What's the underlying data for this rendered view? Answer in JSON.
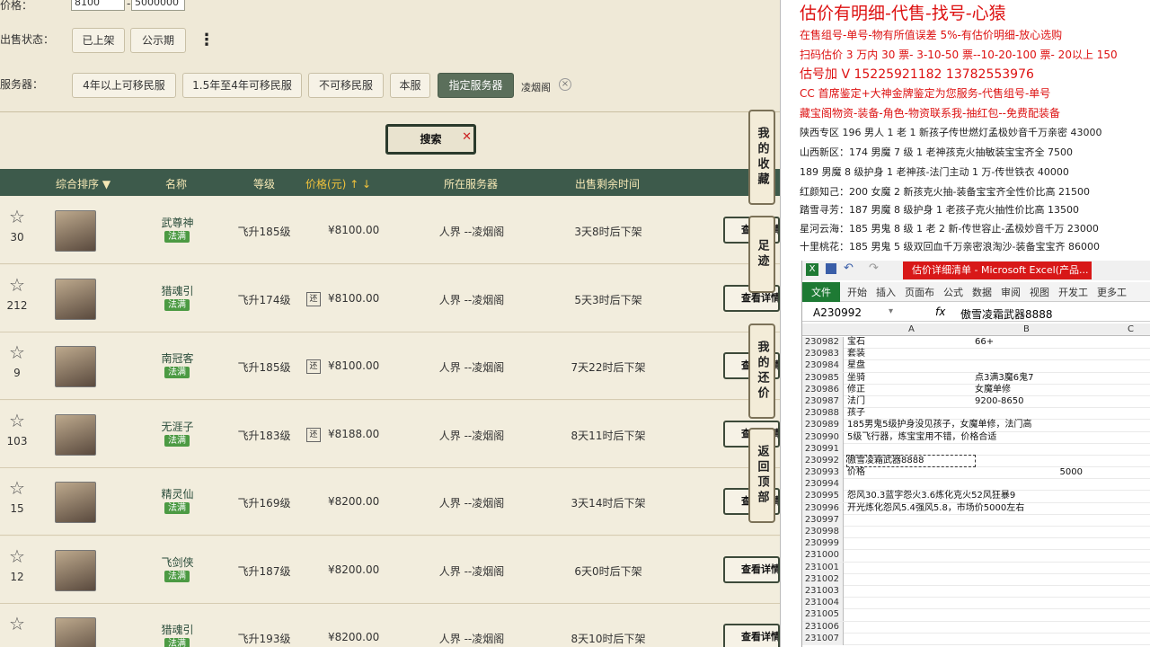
{
  "filters": {
    "price_label": "价格：",
    "price_min": "8100",
    "price_sep": "-",
    "price_max": "5000000",
    "sale_status_label": "出售状态：",
    "sale_status_options": [
      "已上架",
      "公示期"
    ],
    "more": "⋮",
    "server_label": "服务器：",
    "server_options": [
      "4年以上可移民服",
      "1.5年至4年可移民服",
      "不可移民服",
      "本服",
      "指定服务器"
    ],
    "server_selected": "凌烟阁",
    "search_label": "搜索"
  },
  "table": {
    "headers": [
      "综合排序",
      "名称",
      "等级",
      "价格(元)",
      "所在服务器",
      "出售剩余时间"
    ],
    "rows": [
      {
        "fav": "30",
        "name": "武尊神",
        "tag": "法满",
        "level": "飞升185级",
        "hint": "",
        "price": "¥8100.00",
        "server": "人界 --凌烟阁",
        "time": "3天8时后下架",
        "action": "查看详情"
      },
      {
        "fav": "212",
        "name": "猎魂引",
        "tag": "法满",
        "level": "飞升174级",
        "hint": "还",
        "price": "¥8100.00",
        "server": "人界 --凌烟阁",
        "time": "5天3时后下架",
        "action": "查看详情"
      },
      {
        "fav": "9",
        "name": "南冠客",
        "tag": "法满",
        "level": "飞升185级",
        "hint": "还",
        "price": "¥8100.00",
        "server": "人界 --凌烟阁",
        "time": "7天22时后下架",
        "action": "查看详情"
      },
      {
        "fav": "103",
        "name": "无涯子",
        "tag": "法满",
        "level": "飞升183级",
        "hint": "还",
        "price": "¥8188.00",
        "server": "人界 --凌烟阁",
        "time": "8天11时后下架",
        "action": "查看详情"
      },
      {
        "fav": "15",
        "name": "精灵仙",
        "tag": "法满",
        "level": "飞升169级",
        "hint": "",
        "price": "¥8200.00",
        "server": "人界 --凌烟阁",
        "time": "3天14时后下架",
        "action": "查看详情"
      },
      {
        "fav": "12",
        "name": "飞剑侠",
        "tag": "法满",
        "level": "飞升187级",
        "hint": "",
        "price": "¥8200.00",
        "server": "人界 --凌烟阁",
        "time": "6天0时后下架",
        "action": "查看详情"
      },
      {
        "fav": "",
        "name": "猎魂引",
        "tag": "法满",
        "level": "飞升193级",
        "hint": "",
        "price": "¥8200.00",
        "server": "人界 --凌烟阁",
        "time": "8天10时后下架",
        "action": "查看详情"
      }
    ]
  },
  "side_nav": [
    "我的收藏",
    "足迹",
    "我的还价",
    "返回顶部"
  ],
  "promo": {
    "headline": "估价有明细-代售-找号-心猿",
    "red_lines": [
      "在售组号-单号-物有所值误差 5%-有估价明细-放心选购",
      "扫码估价 3 万内 30 票- 3-10-50 票--10-20-100 票- 20以上 150",
      "估号加 V 15225921182   13782553976",
      "CC 首席鉴定+大神金牌鉴定为您服务-代售组号-单号",
      "藏宝阁物资-装备-角色-物资联系我-抽红包--免费配装备"
    ],
    "listings": [
      "陕西专区 196 男人 1 老 1 新孩子传世燃灯孟极妙音千万亲密 43000",
      "山西新区：174 男魔 7 级 1 老神孩克火抽敏装宝宝齐全 7500",
      "189 男魔 8 级护身 1 老神孩-法门主动 1 万-传世铁衣 40000",
      "红颜知己：200 女魔 2 新孩克火抽-装备宝宝齐全性价比高 21500",
      "踏雪寻芳：187 男魔 8 级护身 1 老孩子克火抽性价比高 13500",
      "星河云海：185 男鬼 8 级 1 老 2 新-传世容止-孟极妙音千万 23000",
      "十里桃花：185 男鬼 5 级双回血千万亲密浪淘沙-装备宝宝齐 86000"
    ]
  },
  "excel": {
    "title": "估价详细清单 - Microsoft Excel(产品...",
    "menu": [
      "文件",
      "开始",
      "插入",
      "页面布",
      "公式",
      "数据",
      "审阅",
      "视图",
      "开发工",
      "更多工"
    ],
    "cell_ref": "A230992",
    "fx": "fx",
    "formula": "傲雪凌霜武器8888",
    "columns": [
      "A",
      "B",
      "C"
    ],
    "rows": [
      {
        "n": "230982",
        "a": "宝石",
        "b": "66+"
      },
      {
        "n": "230983",
        "a": "套装",
        "b": ""
      },
      {
        "n": "230984",
        "a": "星盘",
        "b": ""
      },
      {
        "n": "230985",
        "a": "坐骑",
        "b": "点3满3魔6鬼7"
      },
      {
        "n": "230986",
        "a": "修正",
        "b": "女魔单修"
      },
      {
        "n": "230987",
        "a": "法门",
        "b": "9200-8650"
      },
      {
        "n": "230988",
        "a": "孩子",
        "b": ""
      },
      {
        "n": "230989",
        "a": "185男鬼5级护身没见孩子，女魔单修，法门高",
        "b": ""
      },
      {
        "n": "230990",
        "a": "5级飞行器，炼宝宝用不错，价格合适",
        "b": ""
      },
      {
        "n": "230991",
        "a": "",
        "b": ""
      },
      {
        "n": "230992",
        "a": "傲雪凌霜武器8888",
        "b": ""
      },
      {
        "n": "230993",
        "a": "价格",
        "b": "5000"
      },
      {
        "n": "230994",
        "a": "",
        "b": ""
      },
      {
        "n": "230995",
        "a": "怨风30.3蓝字怨火3.6炼化克火52风狂暴9",
        "b": ""
      },
      {
        "n": "230996",
        "a": "开光炼化怨风5.4强风5.8，市场价5000左右",
        "b": ""
      },
      {
        "n": "230997",
        "a": "",
        "b": ""
      },
      {
        "n": "230998",
        "a": "",
        "b": ""
      },
      {
        "n": "230999",
        "a": "",
        "b": ""
      },
      {
        "n": "231000",
        "a": "",
        "b": ""
      },
      {
        "n": "231001",
        "a": "",
        "b": ""
      },
      {
        "n": "231002",
        "a": "",
        "b": ""
      },
      {
        "n": "231003",
        "a": "",
        "b": ""
      },
      {
        "n": "231004",
        "a": "",
        "b": ""
      },
      {
        "n": "231005",
        "a": "",
        "b": ""
      },
      {
        "n": "231006",
        "a": "",
        "b": ""
      },
      {
        "n": "231007",
        "a": "",
        "b": ""
      }
    ]
  }
}
